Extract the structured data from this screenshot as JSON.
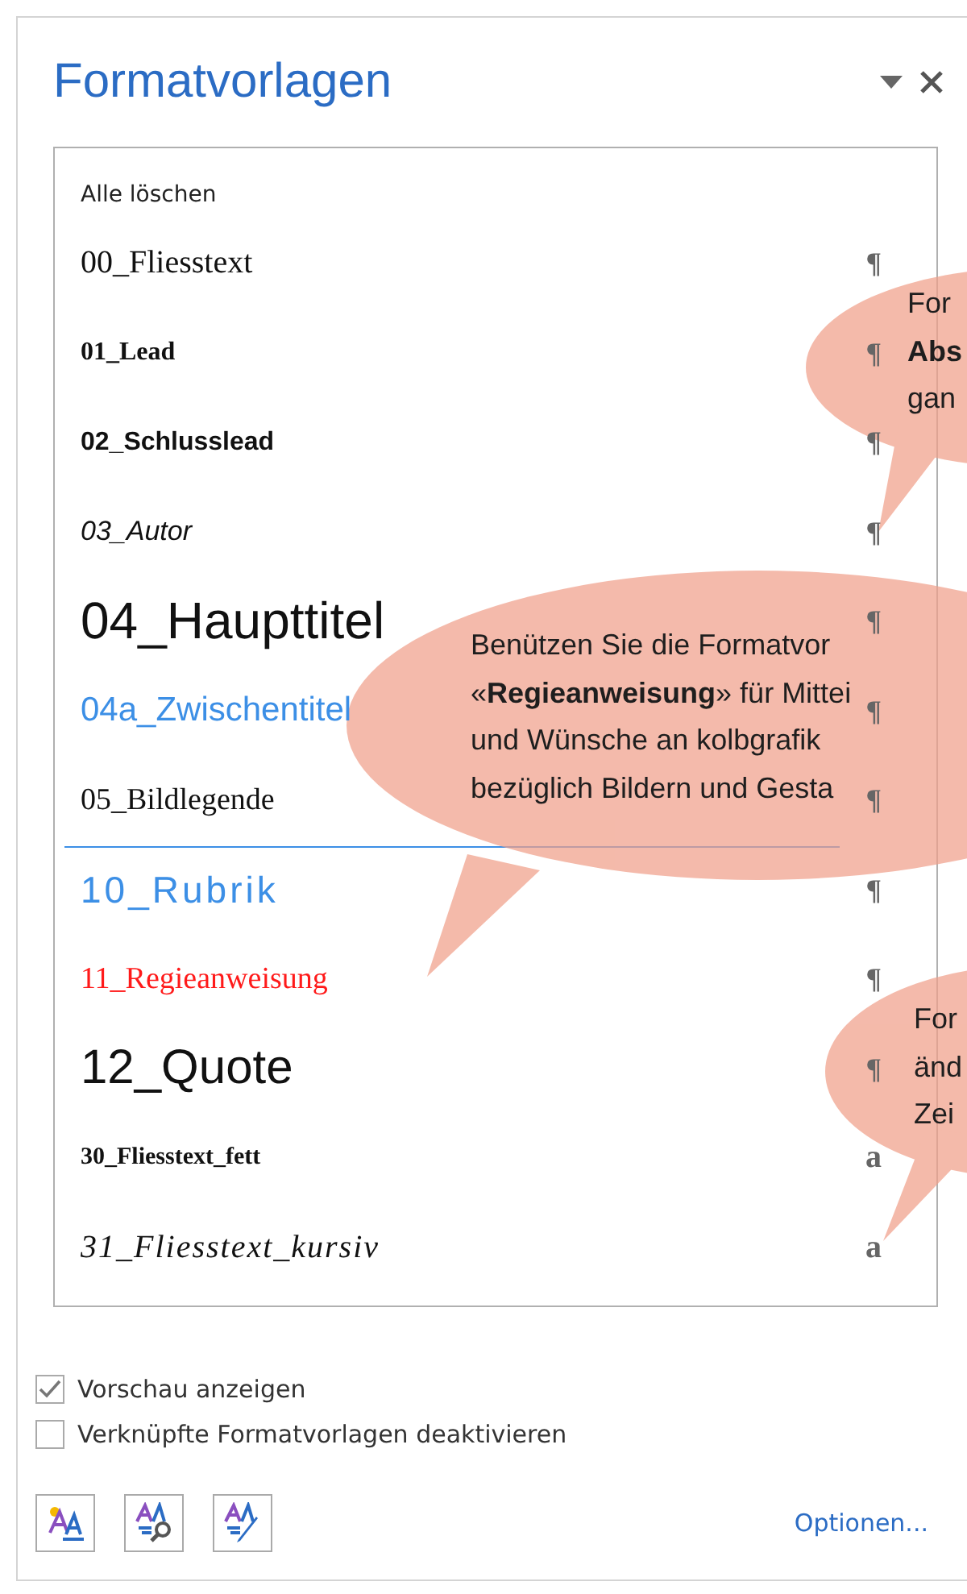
{
  "pane": {
    "title": "Formatvorlagen"
  },
  "styles_list": {
    "clear_all": "Alle löschen",
    "items": [
      {
        "name": "00_Fliesstext",
        "kind": "paragraph",
        "mark": "¶"
      },
      {
        "name": "01_Lead",
        "kind": "paragraph",
        "mark": "¶"
      },
      {
        "name": "02_Schlusslead",
        "kind": "paragraph",
        "mark": "¶"
      },
      {
        "name": "03_Autor",
        "kind": "paragraph",
        "mark": "¶"
      },
      {
        "name": "04_Haupttitel",
        "kind": "paragraph",
        "mark": "¶"
      },
      {
        "name": "04a_Zwischentitel",
        "kind": "paragraph",
        "mark": "¶",
        "color": "#3c8fe6"
      },
      {
        "name": "05_Bildlegende",
        "kind": "paragraph",
        "mark": "¶"
      },
      {
        "name": "10_Rubrik",
        "kind": "paragraph",
        "mark": "¶",
        "color": "#3c8fe6"
      },
      {
        "name": "11_Regieanweisung",
        "kind": "paragraph",
        "mark": "¶",
        "color": "#ff1a1a"
      },
      {
        "name": "12_Quote",
        "kind": "paragraph",
        "mark": "¶"
      },
      {
        "name": "30_Fliesstext_fett",
        "kind": "character",
        "mark": "a"
      },
      {
        "name": "31_Fliesstext_kursiv",
        "kind": "character",
        "mark": "a"
      }
    ]
  },
  "options": [
    {
      "label": "Vorschau anzeigen",
      "checked": true
    },
    {
      "label": "Verknüpfte Formatvorlagen deaktivieren",
      "checked": false
    }
  ],
  "footer": {
    "link": "Optionen..."
  },
  "callouts": [
    {
      "lines": [
        "For",
        "**Abs**",
        "gan"
      ]
    },
    {
      "lines": [
        "Benützen Sie die Formatvor",
        "«**Regieanweisung**» für Mittei",
        "und Wünsche an kolbgrafik",
        "bezüglich Bildern und Gesta"
      ]
    },
    {
      "lines": [
        "For",
        "änd",
        "Zei"
      ]
    }
  ]
}
